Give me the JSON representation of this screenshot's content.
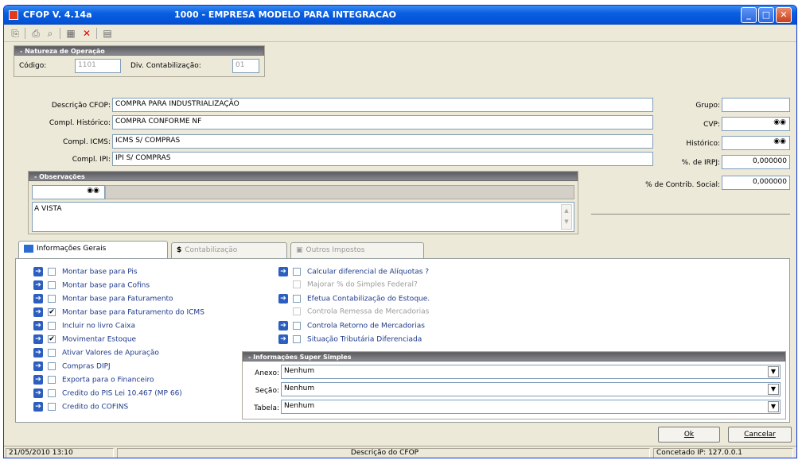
{
  "window": {
    "title": "CFOP V. 4.14a",
    "company": "1000 - EMPRESA MODELO PARA INTEGRACAO",
    "buttons": {
      "minimize": "_",
      "maximize": "□",
      "close": "✕"
    }
  },
  "natureza": {
    "group_title": "- Natureza de Operação",
    "codigo_label": "Código:",
    "codigo_value": "1101",
    "div_label": "Div. Contabilização:",
    "div_value": "01"
  },
  "form": {
    "descricao_label": "Descrição CFOP:",
    "descricao_value": "COMPRA PARA INDUSTRIALIZAÇÃO",
    "compl_hist_label": "Compl. Histórico:",
    "compl_hist_value": "COMPRA CONFORME NF",
    "compl_icms_label": "Compl. ICMS:",
    "compl_icms_value": "ICMS S/ COMPRAS",
    "compl_ipi_label": "Compl. IPI:",
    "compl_ipi_value": "IPI S/ COMPRAS",
    "grupo_label": "Grupo:",
    "grupo_value": "",
    "cvp_label": "CVP:",
    "historico_label": "Histórico:",
    "irpj_label": "%. de IRPJ:",
    "irpj_value": "0,000000",
    "contrib_label": "% de Contrib. Social:",
    "contrib_value": "0,000000"
  },
  "observacoes": {
    "group_title": "- Observações",
    "text": "A VISTA"
  },
  "tabs": [
    {
      "label": "Informações Gerais"
    },
    {
      "label": "Contabilização"
    },
    {
      "label": "Outros Impostos"
    }
  ],
  "left_options": [
    {
      "label": "Montar base para Pis",
      "checked": false
    },
    {
      "label": "Montar base para Cofins",
      "checked": false
    },
    {
      "label": "Montar base para Faturamento",
      "checked": false
    },
    {
      "label": "Montar base para Faturamento do ICMS",
      "checked": true
    },
    {
      "label": "Incluir no livro Caixa",
      "checked": false
    },
    {
      "label": "Movimentar Estoque",
      "checked": true
    },
    {
      "label": "Ativar Valores de Apuração",
      "checked": false
    },
    {
      "label": "Compras DIPJ",
      "checked": false
    },
    {
      "label": "Exporta para o Financeiro",
      "checked": false
    },
    {
      "label": "Credito do PIS Lei 10.467 (MP 66)",
      "checked": false
    },
    {
      "label": "Credito do COFINS",
      "checked": false
    }
  ],
  "right_options": [
    {
      "label": "Calcular diferencial de Alíquotas ?",
      "checked": false,
      "enabled": true
    },
    {
      "label": "Majorar % do Simples Federal?",
      "checked": false,
      "enabled": false
    },
    {
      "label": "Efetua Contabilização do Estoque.",
      "checked": false,
      "enabled": true
    },
    {
      "label": "Controla Remessa de Mercadorias",
      "checked": false,
      "enabled": false
    },
    {
      "label": "Controla Retorno de Mercadorias",
      "checked": false,
      "enabled": true
    },
    {
      "label": "Situação Tributária Diferenciada",
      "checked": false,
      "enabled": true
    }
  ],
  "super_simples": {
    "group_title": "- Informações Super Simples",
    "anexo_label": "Anexo:",
    "anexo_value": "Nenhum",
    "secao_label": "Seção:",
    "secao_value": "Nenhum",
    "tabela_label": "Tabela:",
    "tabela_value": "Nenhum"
  },
  "actions": {
    "ok": "Ok",
    "cancel": "Cancelar"
  },
  "status": {
    "datetime": "21/05/2010  13:10",
    "hint": "Descrição do CFOP",
    "connection": "Concetado  IP:  127.0.0.1"
  }
}
